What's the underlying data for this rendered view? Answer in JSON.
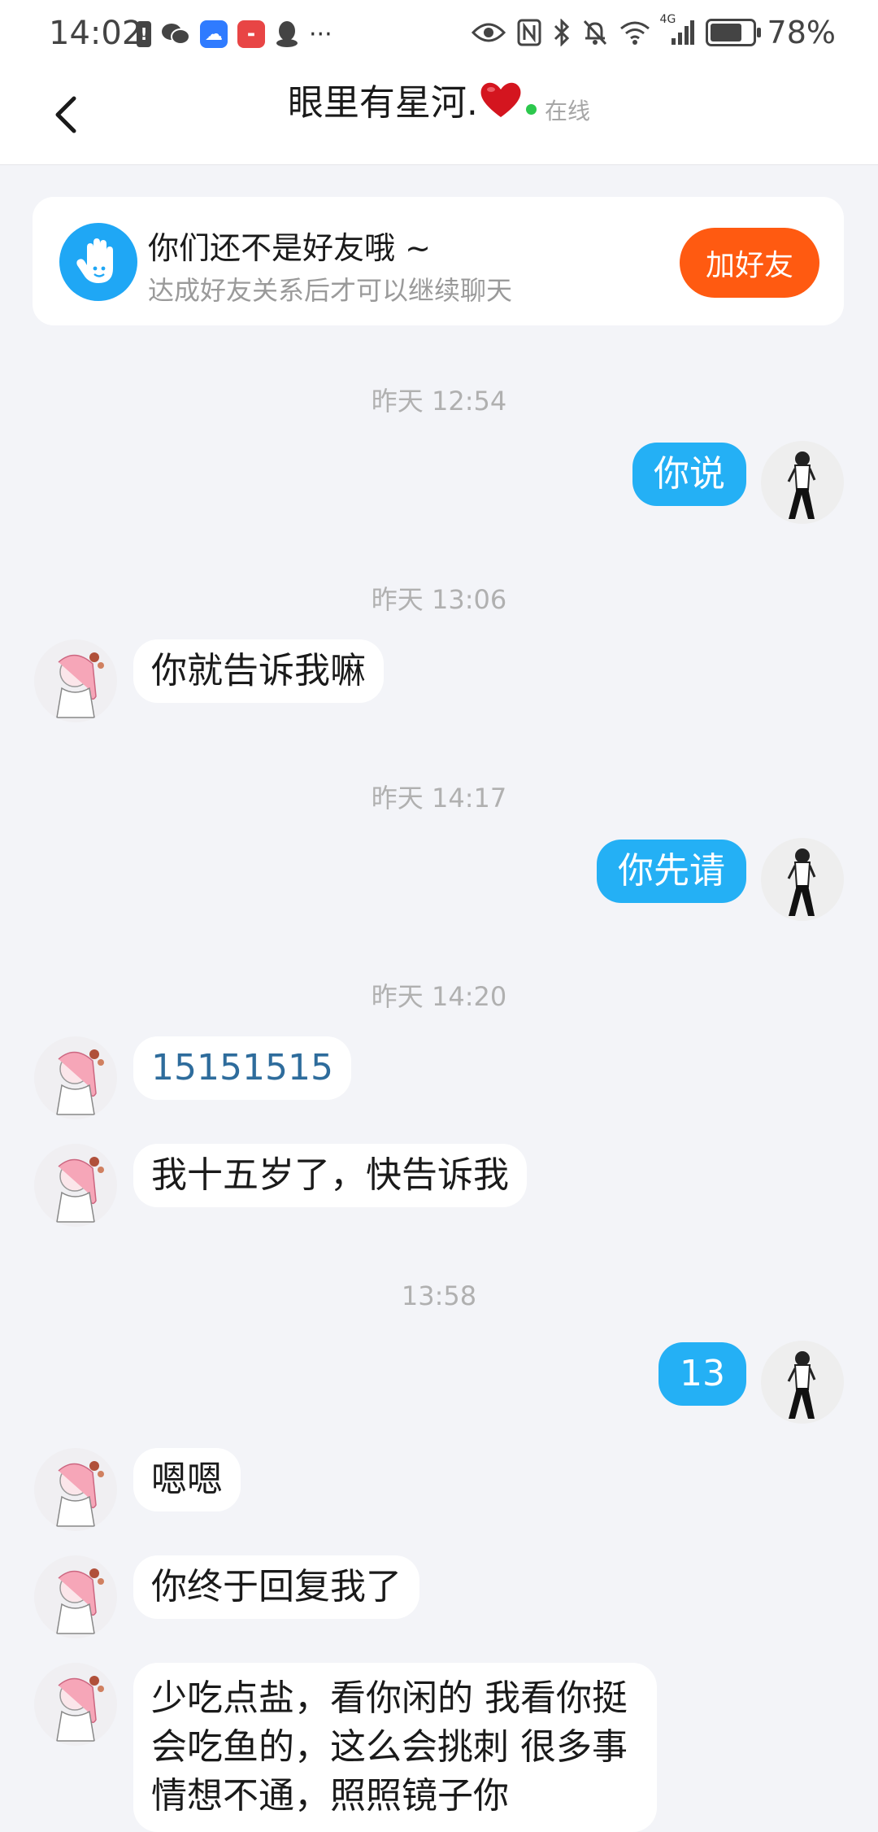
{
  "status_bar": {
    "time": "14:02",
    "more": "···",
    "battery_pct": "78%",
    "network": "4G"
  },
  "header": {
    "title": "眼里有星河.",
    "status": "在线"
  },
  "friend_banner": {
    "title": "你们还不是好友哦 ~",
    "subtitle": "达成好友关系后才可以继续聊天",
    "button": "加好友"
  },
  "colors": {
    "outgoing_bubble": "#24b0f5",
    "add_button": "#ff5a11",
    "online_dot": "#2cc84d",
    "link_text": "#2e6c9c"
  },
  "messages": [
    {
      "timestamp": "昨天 12:54"
    },
    {
      "from": "me",
      "text": "你说"
    },
    {
      "timestamp": "昨天 13:06"
    },
    {
      "from": "other",
      "text": "你就告诉我嘛"
    },
    {
      "timestamp": "昨天 14:17"
    },
    {
      "from": "me",
      "text": "你先请"
    },
    {
      "timestamp": "昨天 14:20"
    },
    {
      "from": "other",
      "text": "15151515"
    },
    {
      "from": "other",
      "text": "我十五岁了，快告诉我"
    },
    {
      "timestamp": "13:58"
    },
    {
      "from": "me",
      "text": "13"
    },
    {
      "from": "other",
      "text": "嗯嗯"
    },
    {
      "from": "other",
      "text": "你终于回复我了"
    },
    {
      "from": "other",
      "text": "少吃点盐，看你闲的 我看你挺会吃鱼的，这么会挑刺 很多事情想不通，照照镜子你"
    }
  ]
}
